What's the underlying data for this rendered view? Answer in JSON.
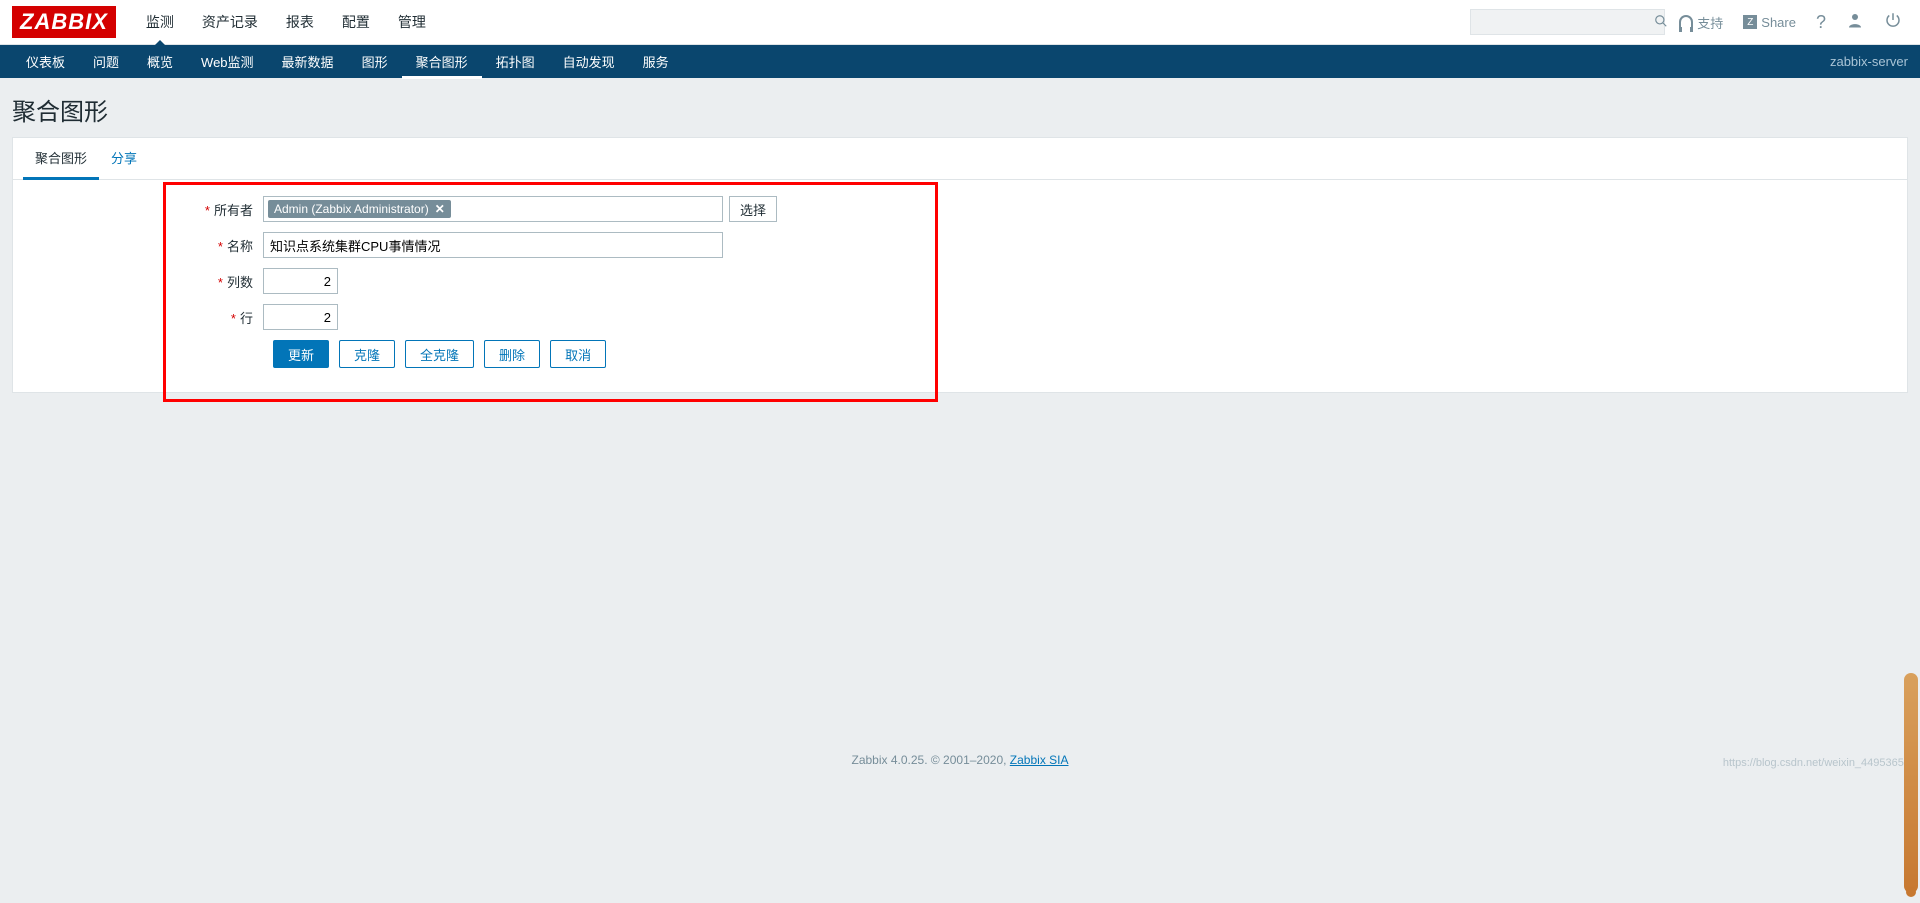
{
  "logo": "ZABBIX",
  "main_nav": {
    "items": [
      "监测",
      "资产记录",
      "报表",
      "配置",
      "管理"
    ],
    "active": 0
  },
  "top_right": {
    "support": "支持",
    "share": "Share",
    "help": "?",
    "search_placeholder": ""
  },
  "sub_nav": {
    "items": [
      "仪表板",
      "问题",
      "概览",
      "Web监测",
      "最新数据",
      "图形",
      "聚合图形",
      "拓扑图",
      "自动发现",
      "服务"
    ],
    "active": 6,
    "server": "zabbix-server"
  },
  "page_title": "聚合图形",
  "tabs": {
    "items": [
      "聚合图形",
      "分享"
    ],
    "active": 0
  },
  "form": {
    "owner": {
      "label": "所有者",
      "tag": "Admin (Zabbix Administrator)",
      "select_btn": "选择"
    },
    "name": {
      "label": "名称",
      "value": "知识点系统集群CPU事情情况"
    },
    "cols": {
      "label": "列数",
      "value": "2"
    },
    "rows": {
      "label": "行",
      "value": "2"
    }
  },
  "buttons": {
    "update": "更新",
    "clone": "克隆",
    "full_clone": "全克隆",
    "delete": "删除",
    "cancel": "取消"
  },
  "footer": {
    "text": "Zabbix 4.0.25. © 2001–2020, ",
    "link": "Zabbix SIA",
    "watermark": "https://blog.csdn.net/weixin_44953658"
  }
}
